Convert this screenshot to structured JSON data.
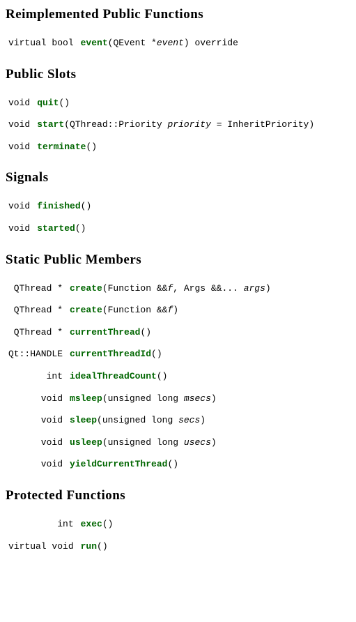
{
  "sections": [
    {
      "id": "reimplemented-public-functions",
      "title": "Reimplemented Public Functions",
      "rows": [
        {
          "ret": "virtual bool",
          "name": "event",
          "sig_html": "(QEvent *<span class=\"param\">event</span>) override"
        }
      ]
    },
    {
      "id": "public-slots",
      "title": "Public Slots",
      "rows": [
        {
          "ret": "void",
          "name": "quit",
          "sig_html": "()"
        },
        {
          "ret": "void",
          "name": "start",
          "sig_html": "(QThread::Priority <span class=\"param\">priority</span> = InheritPriority)"
        },
        {
          "ret": "void",
          "name": "terminate",
          "sig_html": "()"
        }
      ]
    },
    {
      "id": "signals",
      "title": "Signals",
      "rows": [
        {
          "ret": "void",
          "name": "finished",
          "sig_html": "()"
        },
        {
          "ret": "void",
          "name": "started",
          "sig_html": "()"
        }
      ]
    },
    {
      "id": "static-public-members",
      "title": "Static Public Members",
      "rows": [
        {
          "ret": "QThread *",
          "name": "create",
          "sig_html": "(Function &amp;&amp;<span class=\"param\">f</span>, Args &amp;&amp;... <span class=\"param\">args</span>)"
        },
        {
          "ret": "QThread *",
          "name": "create",
          "sig_html": "(Function &amp;&amp;<span class=\"param\">f</span>)"
        },
        {
          "ret": "QThread *",
          "name": "currentThread",
          "sig_html": "()"
        },
        {
          "ret": "Qt::HANDLE",
          "name": "currentThreadId",
          "sig_html": "()"
        },
        {
          "ret": "int",
          "name": "idealThreadCount",
          "sig_html": "()"
        },
        {
          "ret": "void",
          "name": "msleep",
          "sig_html": "(unsigned long <span class=\"param\">msecs</span>)"
        },
        {
          "ret": "void",
          "name": "sleep",
          "sig_html": "(unsigned long <span class=\"param\">secs</span>)"
        },
        {
          "ret": "void",
          "name": "usleep",
          "sig_html": "(unsigned long <span class=\"param\">usecs</span>)"
        },
        {
          "ret": "void",
          "name": "yieldCurrentThread",
          "sig_html": "()"
        }
      ]
    },
    {
      "id": "protected-functions",
      "title": "Protected Functions",
      "rows": [
        {
          "ret": "int",
          "name": "exec",
          "sig_html": "()"
        },
        {
          "ret": "virtual void",
          "name": "run",
          "sig_html": "()"
        }
      ]
    }
  ]
}
